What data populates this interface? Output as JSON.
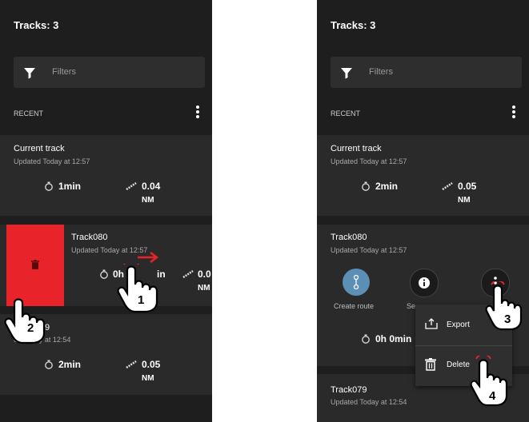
{
  "left": {
    "title": "Tracks: 3",
    "filters_label": "Filters",
    "section_label": "RECENT",
    "current": {
      "title": "Current track",
      "updated": "Updated Today at 12:57",
      "duration": "1min",
      "distance": "0.04",
      "unit": "NM"
    },
    "track080": {
      "title": "Track080",
      "updated": "Updated Today at 12:57",
      "duration": "0h",
      "duration_tail": "in",
      "distance": "0.0",
      "unit": "NM"
    },
    "track079": {
      "title_fragment": "9",
      "updated_fragment": "ed Today at 12:54",
      "duration": "2min",
      "distance": "0.05",
      "unit": "NM"
    },
    "step1": "1",
    "step2": "2"
  },
  "right": {
    "title": "Tracks: 3",
    "filters_label": "Filters",
    "section_label": "RECENT",
    "current": {
      "title": "Current track",
      "updated": "Updated Today at 12:57",
      "duration": "2min",
      "distance": "0.05",
      "unit": "NM"
    },
    "track080": {
      "title": "Track080",
      "updated": "Updated Today at 12:57",
      "duration": "0h 0min",
      "create_route": "Create route",
      "second_fragment": "Se"
    },
    "menu": {
      "export": "Export",
      "delete": "Delete"
    },
    "track079": {
      "title": "Track079",
      "updated": "Updated Today at 12:54"
    },
    "step3": "3",
    "step4": "4"
  },
  "colors": {
    "panel_bg": "#1e1e1e",
    "card_bg": "#2a2a2a",
    "swipe_red": "#e8242a",
    "route_blue": "#5b8fb5",
    "arrow_red": "#e8242a"
  }
}
